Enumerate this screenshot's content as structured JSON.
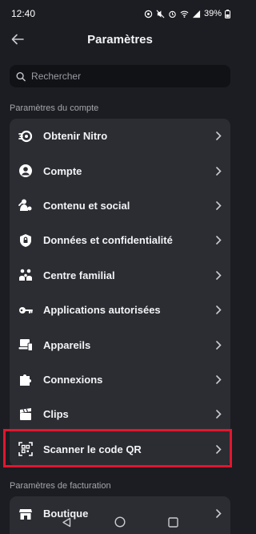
{
  "status": {
    "time": "12:40",
    "battery": "39%"
  },
  "header": {
    "title": "Paramètres"
  },
  "search": {
    "placeholder": "Rechercher"
  },
  "account_section": {
    "title": "Paramètres du compte",
    "items": [
      {
        "label": "Obtenir Nitro",
        "icon": "nitro-icon"
      },
      {
        "label": "Compte",
        "icon": "account-icon"
      },
      {
        "label": "Contenu et social",
        "icon": "social-icon"
      },
      {
        "label": "Données et confidentialité",
        "icon": "privacy-shield-icon"
      },
      {
        "label": "Centre familial",
        "icon": "family-icon"
      },
      {
        "label": "Applications autorisées",
        "icon": "key-icon"
      },
      {
        "label": "Appareils",
        "icon": "devices-icon"
      },
      {
        "label": "Connexions",
        "icon": "puzzle-icon"
      },
      {
        "label": "Clips",
        "icon": "clapper-icon"
      },
      {
        "label": "Scanner le code QR",
        "icon": "qr-scan-icon"
      }
    ]
  },
  "billing_section": {
    "title": "Paramètres de facturation",
    "items": [
      {
        "label": "Boutique",
        "icon": "shop-icon"
      }
    ]
  },
  "colors": {
    "background": "#1c1d22",
    "card": "#2b2d33",
    "highlight": "#e3162e",
    "text": "#f2f3f5",
    "muted": "#a3a6ad"
  }
}
